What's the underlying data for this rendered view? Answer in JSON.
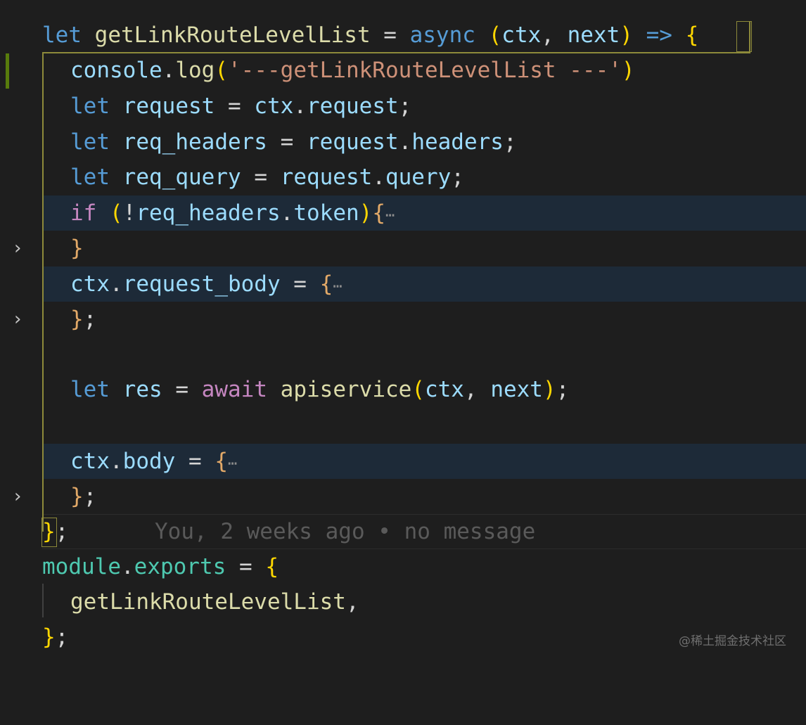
{
  "editor": {
    "lines": {
      "l1": {
        "kw_let": "let",
        "name": "getLinkRouteLevelList",
        "eq": " = ",
        "kw_async": "async",
        "paren_open": "(",
        "p1": "ctx",
        "comma": ", ",
        "p2": "next",
        "paren_close": ")",
        "arrow": "=>",
        "brace_open": "{"
      },
      "l2": {
        "obj": "console",
        "dot": ".",
        "fn": "log",
        "paren_open": "(",
        "str": "'---getLinkRouteLevelList ---'",
        "paren_close": ")"
      },
      "l3": {
        "kw": "let",
        "var": "request",
        "eq": " = ",
        "obj": "ctx",
        "dot": ".",
        "prop": "request",
        "semi": ";"
      },
      "l4": {
        "kw": "let",
        "var": "req_headers",
        "eq": " = ",
        "obj": "request",
        "dot": ".",
        "prop": "headers",
        "semi": ";"
      },
      "l5": {
        "kw": "let",
        "var": "req_query",
        "eq": " = ",
        "obj": "request",
        "dot": ".",
        "prop": "query",
        "semi": ";"
      },
      "l6": {
        "kw": "if",
        "paren_open": "(",
        "not": "!",
        "obj": "req_headers",
        "dot": ".",
        "prop": "token",
        "paren_close": ")",
        "brace_open": "{",
        "ellipsis": "⋯"
      },
      "l7": {
        "brace_close": "}"
      },
      "l8": {
        "obj": "ctx",
        "dot": ".",
        "prop": "request_body",
        "eq": " = ",
        "brace_open": "{",
        "ellipsis": "⋯"
      },
      "l9": {
        "brace_close": "}",
        "semi": ";"
      },
      "l11": {
        "kw": "let",
        "var": "res",
        "eq": " = ",
        "kw_await": "await",
        "fn": "apiservice",
        "paren_open": "(",
        "a1": "ctx",
        "comma": ", ",
        "a2": "next",
        "paren_close": ")",
        "semi": ";"
      },
      "l13": {
        "obj": "ctx",
        "dot": ".",
        "prop": "body",
        "eq": " = ",
        "brace_open": "{",
        "ellipsis": "⋯"
      },
      "l14": {
        "brace_close": "}",
        "semi": ";"
      },
      "l15": {
        "brace_close": "}",
        "semi": ";",
        "blame": "You, 2 weeks ago • no message"
      },
      "l16": {
        "obj": "module",
        "dot": ".",
        "prop": "exports",
        "eq": " = ",
        "brace_open": "{"
      },
      "l17": {
        "name": "getLinkRouteLevelList",
        "comma": ","
      },
      "l18": {
        "brace_close": "}",
        "semi": ";"
      }
    },
    "fold_chevron": "›"
  },
  "watermark": "@稀土掘金技术社区",
  "colors": {
    "background": "#1e1e1e",
    "keyword": "#569cd6",
    "function": "#dcdcaa",
    "variable": "#9cdcfe",
    "string": "#ce9178",
    "control": "#c586c0",
    "module": "#4ec9b0",
    "bracket_gold": "#ffd700",
    "bracket_orange": "#e2a968",
    "folded_highlight": "#1d2a38",
    "gutter_modified": "#587c0c"
  },
  "icons": [
    "chevron-right-icon"
  ]
}
